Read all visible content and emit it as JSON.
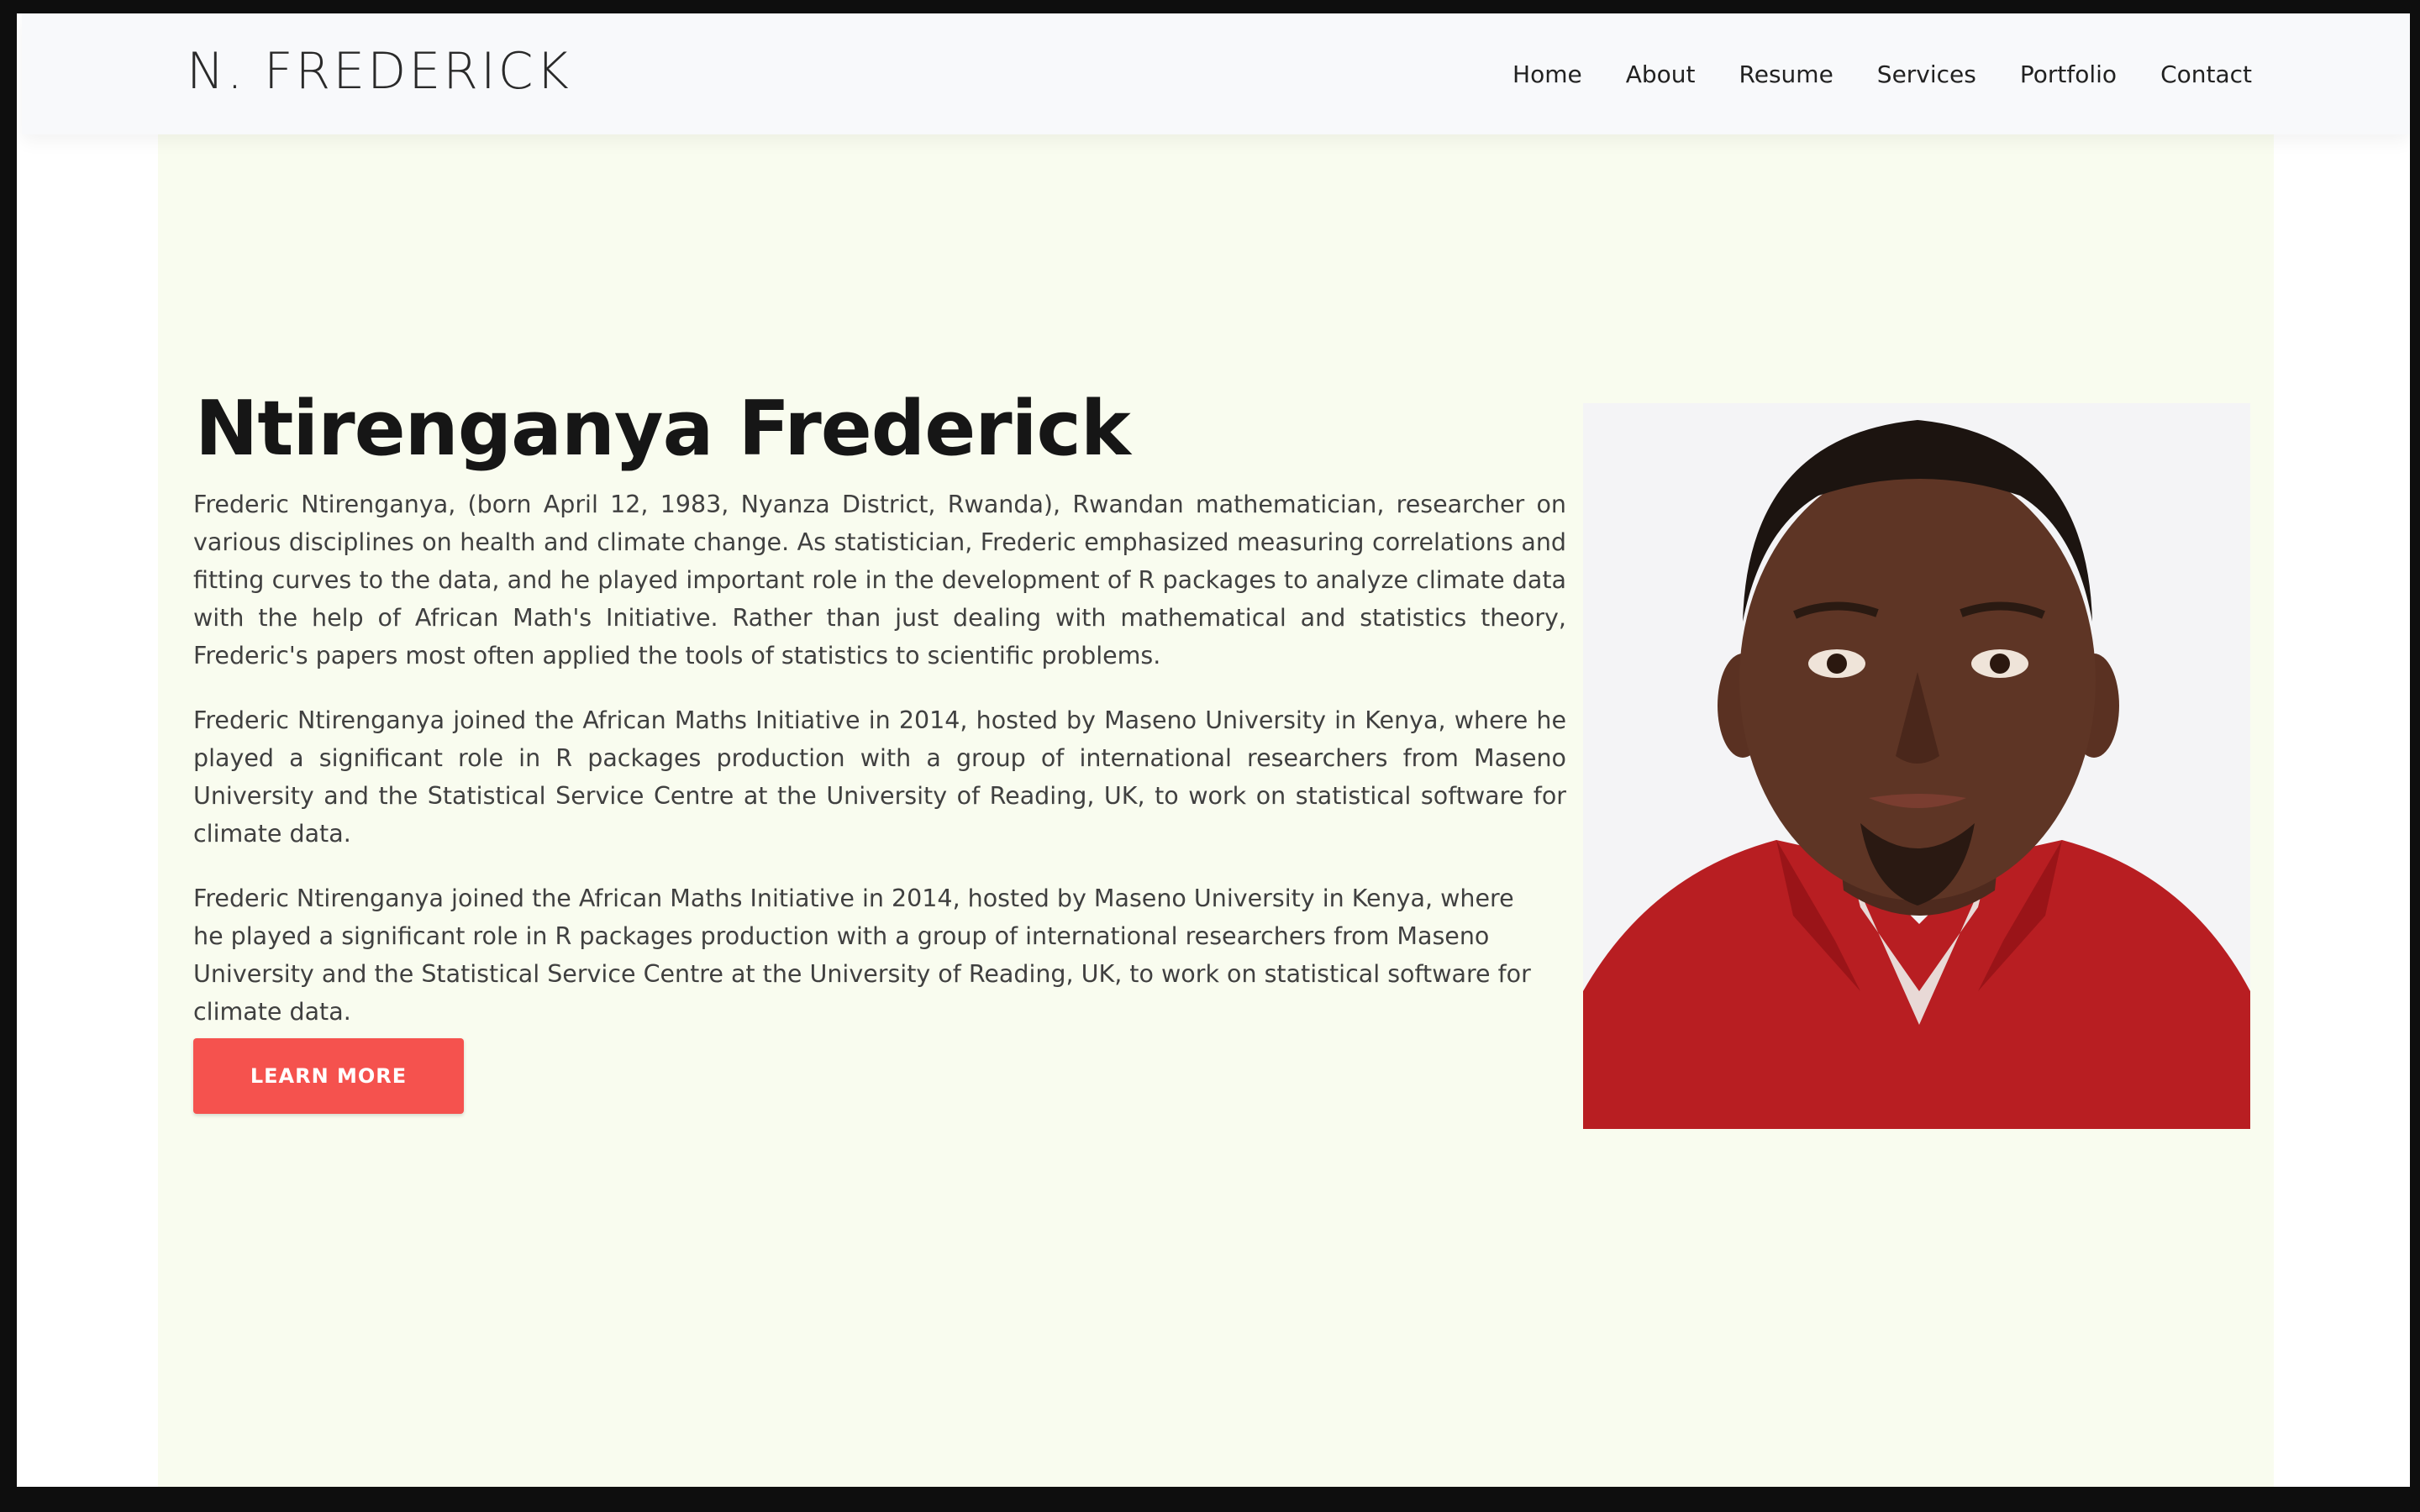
{
  "nav": {
    "brand": "N. FREDERICK",
    "links": [
      "Home",
      "About",
      "Resume",
      "Services",
      "Portfolio",
      "Contact"
    ]
  },
  "hero": {
    "title": "Ntirenganya Frederick",
    "paragraphs": [
      "Frederic Ntirenganya, (born April 12, 1983, Nyanza District, Rwanda), Rwandan mathematician, researcher on various disciplines on health and climate change. As statistician, Frederic emphasized measuring correlations and fitting curves to the data, and he played important role in the development of R packages to analyze climate data with the help of African Math's Initiative. Rather than just dealing with mathematical and statistics theory, Frederic's papers most often applied the tools of statistics to scientific problems.",
      "Frederic Ntirenganya joined the African Maths Initiative in 2014, hosted by Maseno University in Kenya, where he played a significant role in R packages production with a group of international researchers from Maseno University and the Statistical Service Centre at the University of Reading, UK, to work on statistical software for climate data.",
      "Frederic Ntirenganya joined the African Maths Initiative in 2014, hosted by Maseno University in Kenya, where he played a significant role in R packages production with a group of international researchers from Maseno University and the Statistical Service Centre at the University of Reading, UK, to work on statistical software for climate data."
    ],
    "button_label": "LEARN MORE"
  },
  "colors": {
    "accent": "#f5524e",
    "hero_background": "#f9fcef",
    "navbar_background": "#f8f9fb"
  },
  "icons": {
    "portrait": "profile-photo"
  }
}
